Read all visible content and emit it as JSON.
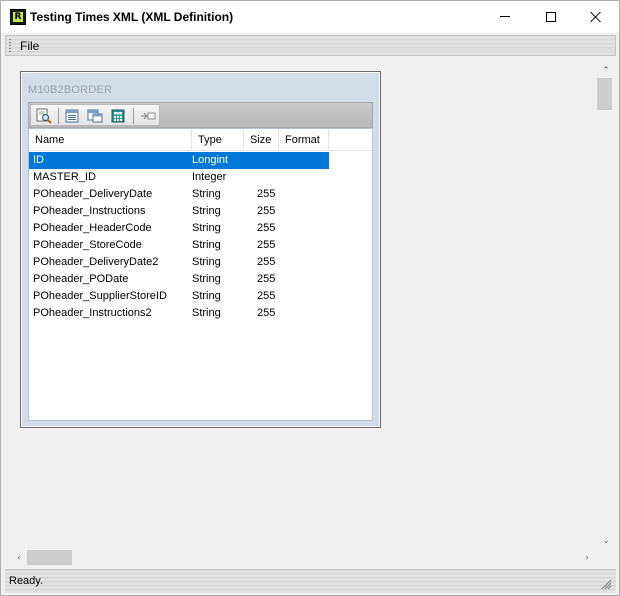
{
  "window": {
    "title": "Testing Times XML (XML Definition)",
    "icon": "app-logo-icon",
    "icon_letter": "R"
  },
  "menu": {
    "items": [
      {
        "label": "File"
      }
    ]
  },
  "child_window": {
    "title": "M10B2BORDER",
    "toolbar": [
      {
        "icon": "preview-magnifier-icon"
      },
      {
        "icon": "table-view-icon"
      },
      {
        "icon": "form-view-icon"
      },
      {
        "icon": "calculator-icon"
      },
      {
        "icon": "insert-field-icon"
      }
    ],
    "grid": {
      "columns": [
        "Name",
        "Type",
        "Size",
        "Format"
      ],
      "rows": [
        {
          "name": "ID",
          "type": "Longint",
          "size": "",
          "selected": true
        },
        {
          "name": "MASTER_ID",
          "type": "Integer",
          "size": ""
        },
        {
          "name": "POheader_DeliveryDate",
          "type": "String",
          "size": "255"
        },
        {
          "name": "POheader_Instructions",
          "type": "String",
          "size": "255"
        },
        {
          "name": "POheader_HeaderCode",
          "type": "String",
          "size": "255"
        },
        {
          "name": "POheader_StoreCode",
          "type": "String",
          "size": "255"
        },
        {
          "name": "POheader_DeliveryDate2",
          "type": "String",
          "size": "255"
        },
        {
          "name": "POheader_PODate",
          "type": "String",
          "size": "255"
        },
        {
          "name": "POheader_SupplierStoreID",
          "type": "String",
          "size": "255"
        },
        {
          "name": "POheader_Instructions2",
          "type": "String",
          "size": "255"
        }
      ]
    }
  },
  "status": {
    "text": "Ready."
  },
  "colors": {
    "selection": "#0078d7",
    "child_background": "#d4dde7",
    "icon_accent": "#c6e94a"
  }
}
